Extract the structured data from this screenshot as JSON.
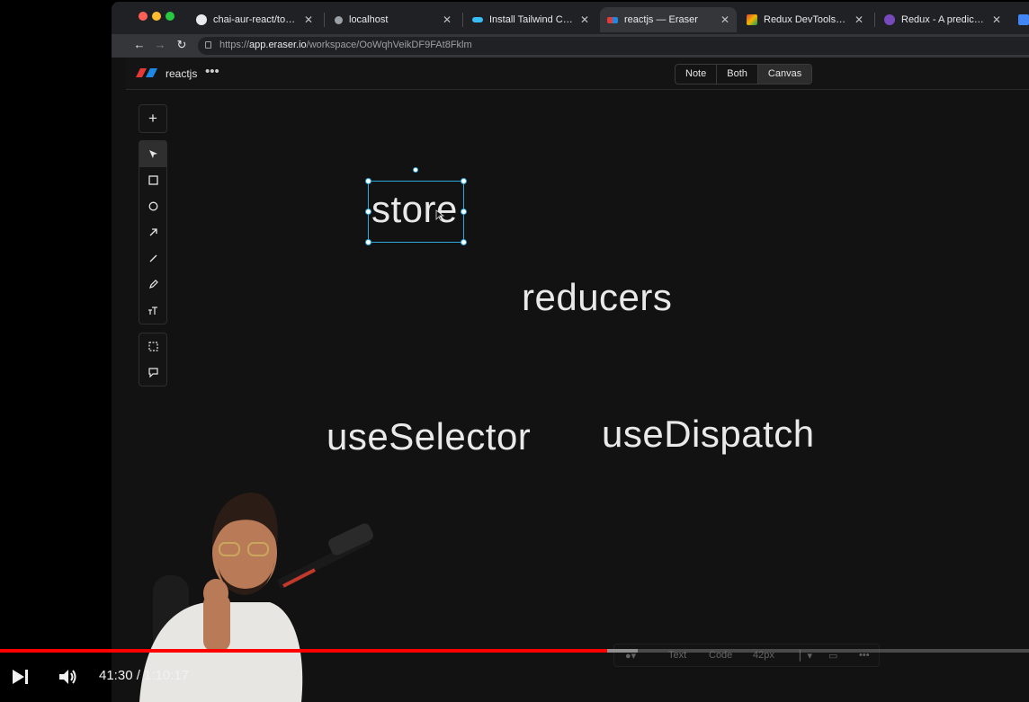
{
  "browser": {
    "tabs": [
      {
        "label": "chai-aur-react/todoContext",
        "favicon": "github-icon",
        "active": false
      },
      {
        "label": "localhost",
        "favicon": "gear-icon",
        "active": false
      },
      {
        "label": "Install Tailwind CSS with Vite",
        "favicon": "tailwind-icon",
        "active": false
      },
      {
        "label": "reactjs — Eraser",
        "favicon": "eraser-icon",
        "active": true
      },
      {
        "label": "Redux DevTools - Chrome Web Store",
        "favicon": "chrome-store-icon",
        "active": false
      },
      {
        "label": "Redux - A predictable state container",
        "favicon": "redux-icon",
        "active": false
      }
    ],
    "url_prefix": "https://",
    "url_host": "app.eraser.io",
    "url_path": "/workspace/OoWqhVeikDF9FAt8Fklm"
  },
  "app": {
    "project_name": "reactjs",
    "more_label": "•••",
    "view_modes": [
      "Note",
      "Both",
      "Canvas"
    ],
    "selected_view": "Canvas"
  },
  "canvas": {
    "tools": {
      "add": "+",
      "items": [
        "select",
        "rectangle",
        "ellipse",
        "arrow",
        "line",
        "pen",
        "text"
      ],
      "extra": [
        "frame",
        "comment"
      ]
    },
    "texts": {
      "store": "store",
      "reducers": "reducers",
      "useSelector": "useSelector",
      "useDispatch": "useDispatch"
    },
    "bottom_toolbar": {
      "text_tab": "Text",
      "code_tab": "Code",
      "font_size": "42px"
    }
  },
  "video": {
    "time_current": "41:30",
    "time_total": "1:10:17",
    "time_display": "41:30 / 1:10:17",
    "progress_fraction": 0.59,
    "buffered_fraction": 0.62,
    "colors": {
      "played": "#ff0000"
    }
  }
}
